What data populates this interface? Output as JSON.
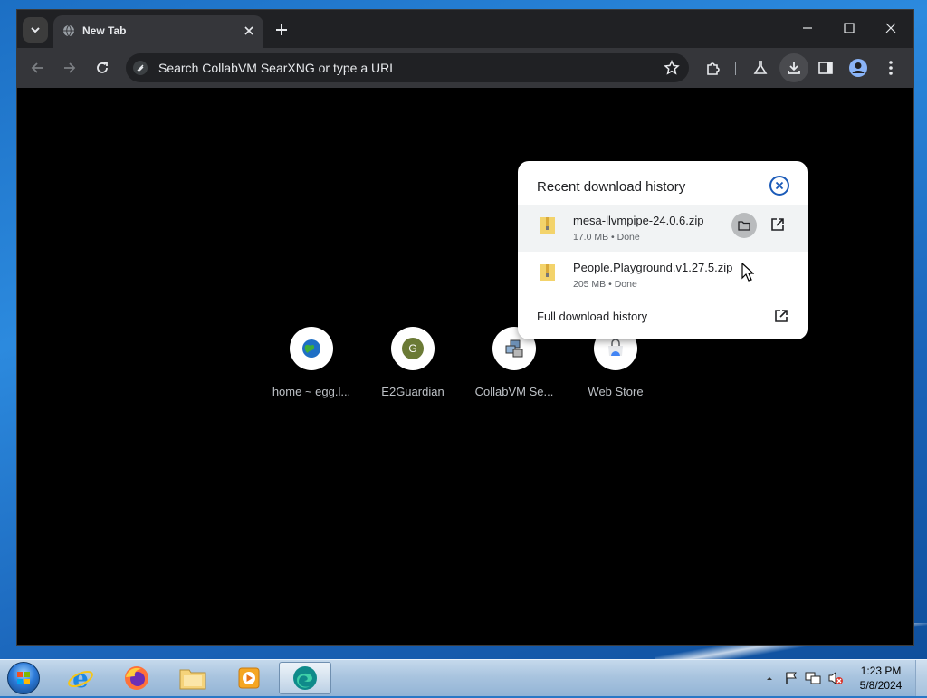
{
  "browser": {
    "tab": {
      "title": "New Tab"
    },
    "omnibox": {
      "placeholder": "Search CollabVM SearXNG or type a URL"
    }
  },
  "downloads": {
    "heading": "Recent download history",
    "items": [
      {
        "name": "mesa-llvmpipe-24.0.6.zip",
        "meta": "17.0 MB • Done"
      },
      {
        "name": "People.Playground.v1.27.5.zip",
        "meta": "205 MB • Done"
      }
    ],
    "full_history_label": "Full download history"
  },
  "shortcuts": [
    {
      "label": "home ~ egg.l...",
      "icon": "globe-icon"
    },
    {
      "label": "E2Guardian",
      "icon": "letter-g-icon",
      "letter": "G"
    },
    {
      "label": "CollabVM Se...",
      "icon": "computers-icon"
    },
    {
      "label": "Web Store",
      "icon": "web-store-icon"
    }
  ],
  "taskbar": {
    "apps": [
      "internet-explorer",
      "firefox",
      "file-explorer",
      "media-player",
      "edge"
    ],
    "clock": {
      "time": "1:23 PM",
      "date": "5/8/2024"
    }
  }
}
